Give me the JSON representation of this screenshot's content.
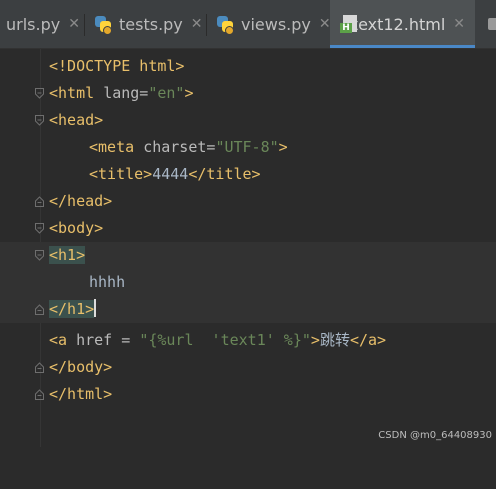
{
  "tabs": [
    {
      "label": "urls.py",
      "active": false,
      "icon": "python-file-icon"
    },
    {
      "label": "tests.py",
      "active": false,
      "icon": "python-file-icon"
    },
    {
      "label": "views.py",
      "active": false,
      "icon": "python-file-icon"
    },
    {
      "label": "text12.html",
      "active": true,
      "icon": "html-file-icon",
      "icon_letter": "H"
    }
  ],
  "close_glyph": "✕",
  "code": {
    "l1": {
      "t": "<!DOCTYPE html>"
    },
    "l2": {
      "open": "<html ",
      "attr": "lang=",
      "str": "\"en\"",
      "close": ">"
    },
    "l3": {
      "t": "<head>"
    },
    "l4": {
      "open": "<meta ",
      "attr": "charset=",
      "str": "\"UTF-8\"",
      "close": ">"
    },
    "l5": {
      "open": "<title>",
      "text": "4444",
      "close": "</title>"
    },
    "l6": {
      "t": "</head>"
    },
    "l7": {
      "t": "<body>"
    },
    "l8": {
      "t": "<h1>"
    },
    "l9": {
      "text": "hhhh"
    },
    "l10": {
      "t": "</h1>"
    },
    "l11": {
      "open": "<a ",
      "attr": "href = ",
      "str": "\"{%url  'text1' %}\"",
      "close": ">",
      "text": "跳转",
      "end": "</a>"
    },
    "l12": {
      "t": "</body>"
    },
    "l13": {
      "t": "</html>"
    }
  },
  "watermark": "CSDN @m0_64408930",
  "colors": {
    "tag": "#e8bf6a",
    "string": "#6a8759",
    "attribute": "#bababa",
    "text": "#a9b7c6",
    "background": "#2b2b2b",
    "tag_match": "#3b514d"
  }
}
